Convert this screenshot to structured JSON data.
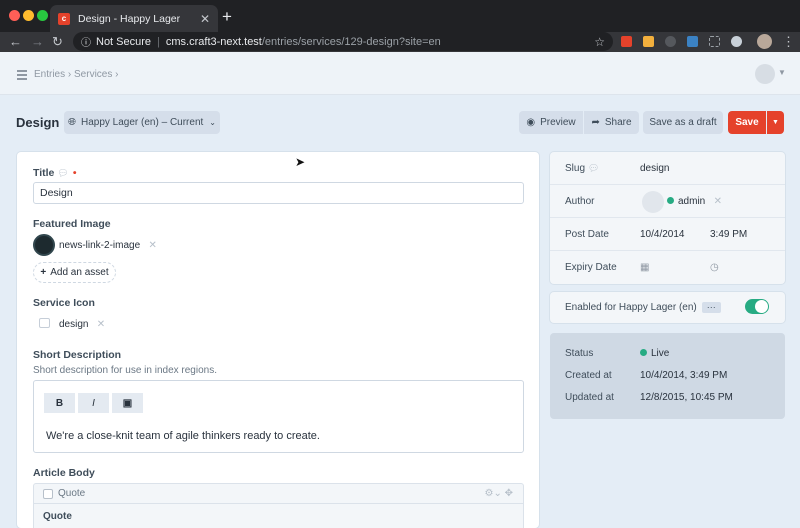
{
  "browser": {
    "tab_title": "Design - Happy Lager",
    "favicon_letter": "c",
    "security_label": "Not Secure",
    "url_host": "cms.craft3-next.test",
    "url_path": "/entries/services/129-design?site=en"
  },
  "header": {
    "breadcrumbs": [
      "Entries",
      "Services"
    ]
  },
  "toolbar": {
    "page_title": "Design",
    "site_label": "Happy Lager (en) – Current",
    "preview_label": "Preview",
    "share_label": "Share",
    "draft_label": "Save as a draft",
    "save_label": "Save"
  },
  "form": {
    "title_label": "Title",
    "title_value": "Design",
    "featured_label": "Featured Image",
    "featured_asset": "news-link-2-image",
    "add_asset_label": "Add an asset",
    "service_icon_label": "Service Icon",
    "service_icon_value": "design",
    "short_desc_label": "Short Description",
    "short_desc_instructions": "Short description for use in index regions.",
    "rte_tools": [
      "B",
      "I"
    ],
    "rte_text": "We're a close-knit team of agile thinkers ready to create.",
    "article_body_label": "Article Body",
    "block_type": "Quote",
    "block_field_label": "Quote"
  },
  "meta": {
    "slug_label": "Slug",
    "slug_value": "design",
    "author_label": "Author",
    "author_value": "admin",
    "post_date_label": "Post Date",
    "post_date": "10/4/2014",
    "post_time": "3:49 PM",
    "expiry_label": "Expiry Date"
  },
  "enabled": {
    "label": "Enabled for Happy Lager (en)",
    "state": true
  },
  "status": {
    "status_label": "Status",
    "status_value": "Live",
    "created_label": "Created at",
    "created_value": "10/4/2014, 3:49 PM",
    "updated_label": "Updated at",
    "updated_value": "12/8/2015, 10:45 PM"
  },
  "colors": {
    "accent": "#e5422b",
    "live": "#27ab83"
  }
}
